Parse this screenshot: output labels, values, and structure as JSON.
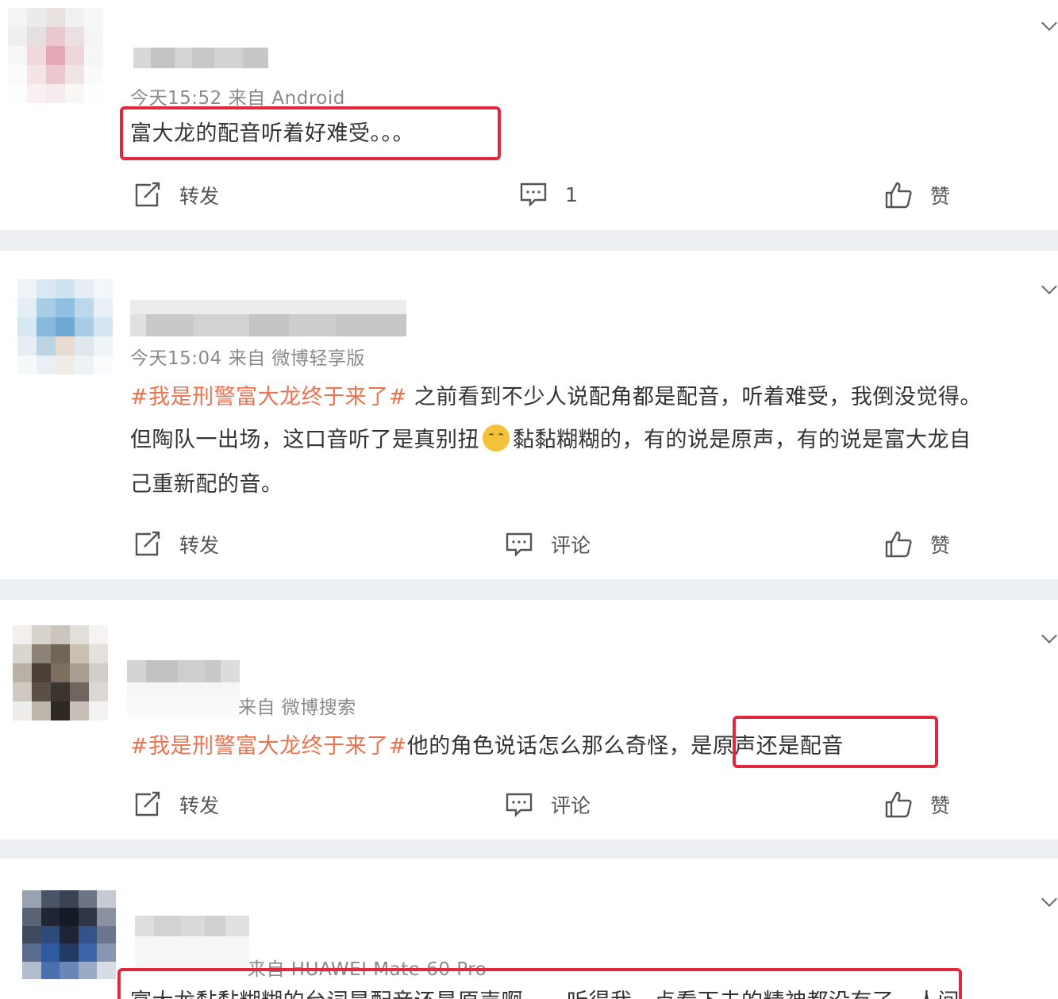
{
  "posts": [
    {
      "meta": "今天15:52  来自 Android",
      "text": "富大龙的配音听着好难受。。。",
      "actions": {
        "repost": "转发",
        "comment": "1",
        "like": "赞"
      }
    },
    {
      "meta": "今天15:04  来自 微博轻享版",
      "tag": "#我是刑警富大龙终于来了#",
      "line1": " 之前看到不少人说配角都是配音，听着难受，我倒没觉得。",
      "line2a": "但陶队一出场，这口音听了是真别扭",
      "line2b": "黏黏糊糊的，有的说是原声，有的说是富大龙自",
      "line3": "己重新配的音。",
      "actions": {
        "repost": "转发",
        "comment": "评论",
        "like": "赞"
      }
    },
    {
      "meta": "来自 微博搜索",
      "tag": "#我是刑警富大龙终于来了#",
      "text": "他的角色说话怎么那么奇怪，",
      "highlight": "是原声还是配音",
      "actions": {
        "repost": "转发",
        "comment": "评论",
        "like": "赞"
      }
    },
    {
      "meta": "来自 HUAWEI Mate 60 Pro",
      "text": "富大龙黏黏糊糊的台词是配音还是原声啊，一听得我一点看下去的精神都没有了，人间"
    }
  ],
  "icons": {
    "repost": "repost-icon",
    "comment": "comment-icon",
    "like": "thumbs-up-icon",
    "more": "chevron-down-icon",
    "emoji": "smile-emoji-icon"
  },
  "colors": {
    "tag": "#eb7350",
    "highlight_border": "#e0293e",
    "page_bg": "#eceff2",
    "meta": "#8a8a8a"
  }
}
